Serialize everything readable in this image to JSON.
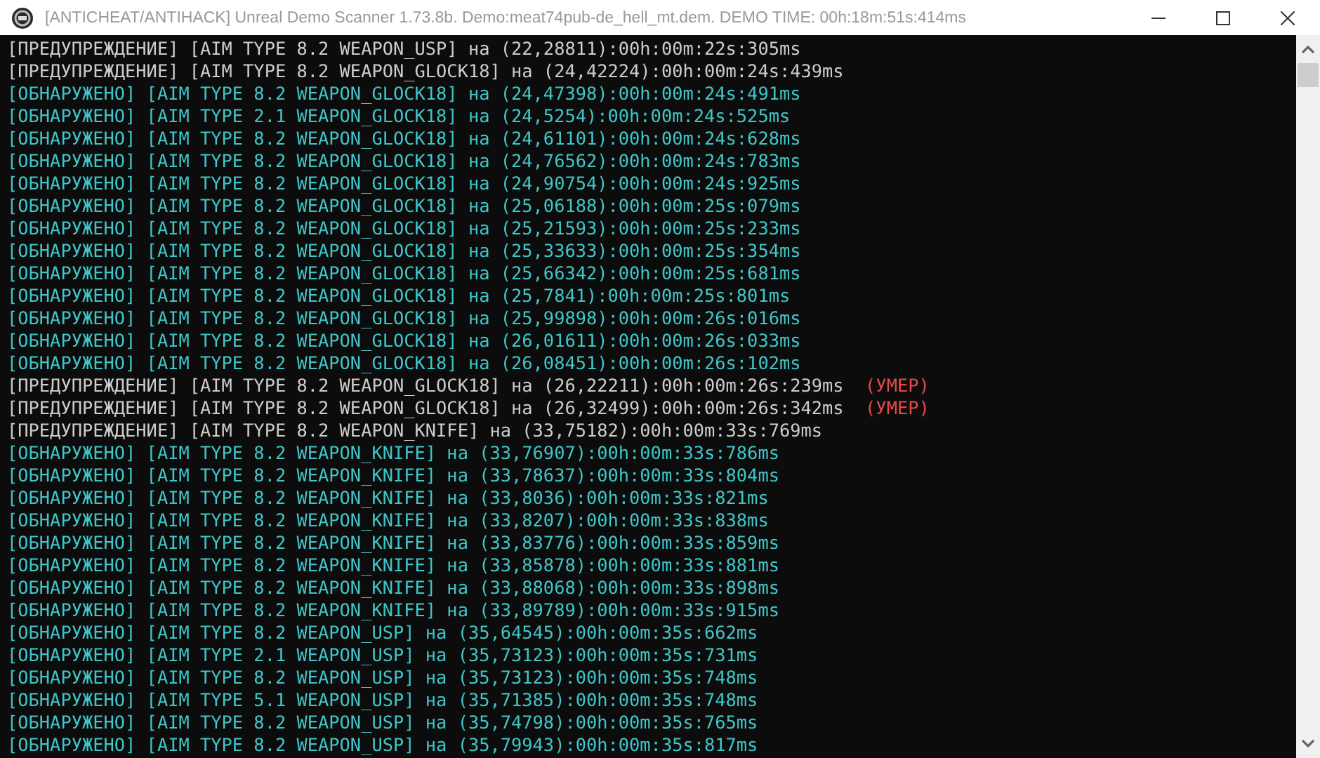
{
  "window": {
    "title": "[ANTICHEAT/ANTIHACK] Unreal Demo Scanner 1.73.8b. Demo:meat74pub-de_hell_mt.dem. DEMO TIME: 00h:18m:51s:414ms"
  },
  "console": {
    "lines": [
      {
        "kind": "warning",
        "text": "[ПРЕДУПРЕЖДЕНИЕ] [AIM TYPE 8.2 WEAPON_USP] на (22,28811):00h:00m:22s:305ms"
      },
      {
        "kind": "warning",
        "text": "[ПРЕДУПРЕЖДЕНИЕ] [AIM TYPE 8.2 WEAPON_GLOCK18] на (24,42224):00h:00m:24s:439ms"
      },
      {
        "kind": "detected",
        "text": "[ОБНАРУЖЕНО] [AIM TYPE 8.2 WEAPON_GLOCK18] на (24,47398):00h:00m:24s:491ms"
      },
      {
        "kind": "detected",
        "text": "[ОБНАРУЖЕНО] [AIM TYPE 2.1 WEAPON_GLOCK18] на (24,5254):00h:00m:24s:525ms"
      },
      {
        "kind": "detected",
        "text": "[ОБНАРУЖЕНО] [AIM TYPE 8.2 WEAPON_GLOCK18] на (24,61101):00h:00m:24s:628ms"
      },
      {
        "kind": "detected",
        "text": "[ОБНАРУЖЕНО] [AIM TYPE 8.2 WEAPON_GLOCK18] на (24,76562):00h:00m:24s:783ms"
      },
      {
        "kind": "detected",
        "text": "[ОБНАРУЖЕНО] [AIM TYPE 8.2 WEAPON_GLOCK18] на (24,90754):00h:00m:24s:925ms"
      },
      {
        "kind": "detected",
        "text": "[ОБНАРУЖЕНО] [AIM TYPE 8.2 WEAPON_GLOCK18] на (25,06188):00h:00m:25s:079ms"
      },
      {
        "kind": "detected",
        "text": "[ОБНАРУЖЕНО] [AIM TYPE 8.2 WEAPON_GLOCK18] на (25,21593):00h:00m:25s:233ms"
      },
      {
        "kind": "detected",
        "text": "[ОБНАРУЖЕНО] [AIM TYPE 8.2 WEAPON_GLOCK18] на (25,33633):00h:00m:25s:354ms"
      },
      {
        "kind": "detected",
        "text": "[ОБНАРУЖЕНО] [AIM TYPE 8.2 WEAPON_GLOCK18] на (25,66342):00h:00m:25s:681ms"
      },
      {
        "kind": "detected",
        "text": "[ОБНАРУЖЕНО] [AIM TYPE 8.2 WEAPON_GLOCK18] на (25,7841):00h:00m:25s:801ms"
      },
      {
        "kind": "detected",
        "text": "[ОБНАРУЖЕНО] [AIM TYPE 8.2 WEAPON_GLOCK18] на (25,99898):00h:00m:26s:016ms"
      },
      {
        "kind": "detected",
        "text": "[ОБНАРУЖЕНО] [AIM TYPE 8.2 WEAPON_GLOCK18] на (26,01611):00h:00m:26s:033ms"
      },
      {
        "kind": "detected",
        "text": "[ОБНАРУЖЕНО] [AIM TYPE 8.2 WEAPON_GLOCK18] на (26,08451):00h:00m:26s:102ms"
      },
      {
        "kind": "warning",
        "text": "[ПРЕДУПРЕЖДЕНИЕ] [AIM TYPE 8.2 WEAPON_GLOCK18] на (26,22211):00h:00m:26s:239ms",
        "note": "(УМЕР)"
      },
      {
        "kind": "warning",
        "text": "[ПРЕДУПРЕЖДЕНИЕ] [AIM TYPE 8.2 WEAPON_GLOCK18] на (26,32499):00h:00m:26s:342ms",
        "note": "(УМЕР)"
      },
      {
        "kind": "warning",
        "text": "[ПРЕДУПРЕЖДЕНИЕ] [AIM TYPE 8.2 WEAPON_KNIFE] на (33,75182):00h:00m:33s:769ms"
      },
      {
        "kind": "detected",
        "text": "[ОБНАРУЖЕНО] [AIM TYPE 8.2 WEAPON_KNIFE] на (33,76907):00h:00m:33s:786ms"
      },
      {
        "kind": "detected",
        "text": "[ОБНАРУЖЕНО] [AIM TYPE 8.2 WEAPON_KNIFE] на (33,78637):00h:00m:33s:804ms"
      },
      {
        "kind": "detected",
        "text": "[ОБНАРУЖЕНО] [AIM TYPE 8.2 WEAPON_KNIFE] на (33,8036):00h:00m:33s:821ms"
      },
      {
        "kind": "detected",
        "text": "[ОБНАРУЖЕНО] [AIM TYPE 8.2 WEAPON_KNIFE] на (33,8207):00h:00m:33s:838ms"
      },
      {
        "kind": "detected",
        "text": "[ОБНАРУЖЕНО] [AIM TYPE 8.2 WEAPON_KNIFE] на (33,83776):00h:00m:33s:859ms"
      },
      {
        "kind": "detected",
        "text": "[ОБНАРУЖЕНО] [AIM TYPE 8.2 WEAPON_KNIFE] на (33,85878):00h:00m:33s:881ms"
      },
      {
        "kind": "detected",
        "text": "[ОБНАРУЖЕНО] [AIM TYPE 8.2 WEAPON_KNIFE] на (33,88068):00h:00m:33s:898ms"
      },
      {
        "kind": "detected",
        "text": "[ОБНАРУЖЕНО] [AIM TYPE 8.2 WEAPON_KNIFE] на (33,89789):00h:00m:33s:915ms"
      },
      {
        "kind": "detected",
        "text": "[ОБНАРУЖЕНО] [AIM TYPE 8.2 WEAPON_USP] на (35,64545):00h:00m:35s:662ms"
      },
      {
        "kind": "detected",
        "text": "[ОБНАРУЖЕНО] [AIM TYPE 2.1 WEAPON_USP] на (35,73123):00h:00m:35s:731ms"
      },
      {
        "kind": "detected",
        "text": "[ОБНАРУЖЕНО] [AIM TYPE 8.2 WEAPON_USP] на (35,73123):00h:00m:35s:748ms"
      },
      {
        "kind": "detected",
        "text": "[ОБНАРУЖЕНО] [AIM TYPE 5.1 WEAPON_USP] на (35,71385):00h:00m:35s:748ms"
      },
      {
        "kind": "detected",
        "text": "[ОБНАРУЖЕНО] [AIM TYPE 8.2 WEAPON_USP] на (35,74798):00h:00m:35s:765ms"
      },
      {
        "kind": "detected",
        "text": "[ОБНАРУЖЕНО] [AIM TYPE 8.2 WEAPON_USP] на (35,79943):00h:00m:35s:817ms"
      }
    ]
  }
}
